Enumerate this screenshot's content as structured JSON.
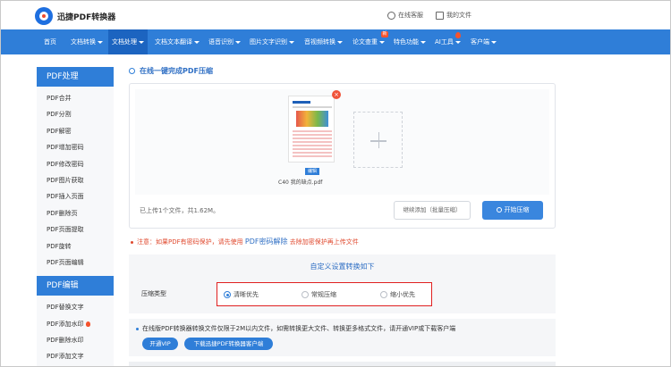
{
  "header": {
    "logo_text": "迅捷PDF转换器",
    "customer_service": "在线客服",
    "my_files": "我的文件"
  },
  "nav": {
    "items": [
      {
        "label": "首页",
        "caret": false
      },
      {
        "label": "文档转换",
        "caret": true
      },
      {
        "label": "文档处理",
        "caret": true
      },
      {
        "label": "文档文本翻译",
        "caret": true
      },
      {
        "label": "语音识别",
        "caret": true
      },
      {
        "label": "图片文字识别",
        "caret": true
      },
      {
        "label": "音视频转换",
        "caret": true
      },
      {
        "label": "论文查重",
        "caret": true
      },
      {
        "label": "特色功能",
        "caret": true
      },
      {
        "label": "AI工具",
        "caret": true
      },
      {
        "label": "客户端",
        "caret": true
      }
    ],
    "new_badge": "新"
  },
  "sidebar": {
    "section1_title": "PDF处理",
    "section1_items": [
      "PDF合并",
      "PDF分割",
      "PDF解密",
      "PDF增加密码",
      "PDF修改密码",
      "PDF图片获取",
      "PDF插入页面",
      "PDF删除页",
      "PDF页面提取",
      "PDF旋转",
      "PDF页面编辑"
    ],
    "section2_title": "PDF编辑",
    "section2_items": [
      "PDF替换文字",
      "PDF添加水印",
      "PDF删除水印",
      "PDF添加文字"
    ]
  },
  "main": {
    "title": "在线一键完成PDF压缩",
    "file": {
      "name": "C40 我的缺点.pdf",
      "edit_label": "编辑",
      "delete_symbol": "×"
    },
    "status": "已上传1个文件，共1.62M。",
    "continue_button": "继续添加（批量压缩）",
    "start_button": "开始压缩",
    "notice_prefix": "注意：如果PDF有密码保护，请先使用",
    "notice_link": "PDF密码解除",
    "notice_suffix": "去除加密保护再上传文件",
    "settings": {
      "title": "自定义设置转换如下",
      "compress_type_label": "压缩类型",
      "options": [
        {
          "label": "清晰优先",
          "checked": true
        },
        {
          "label": "常规压缩",
          "checked": false
        },
        {
          "label": "缩小优先",
          "checked": false
        }
      ]
    },
    "vip": {
      "text": "在线版PDF转换器转换文件仅限于2M以内文件，如需转换更大文件、转换更多格式文件，请开通VIP或下载客户端",
      "vip_button": "开通VIP",
      "download_button": "下载迅捷PDF转换器客户端"
    }
  },
  "colors": {
    "primary": "#2f7ed8",
    "warning": "#e04a2f",
    "highlight_border": "#e02020"
  }
}
